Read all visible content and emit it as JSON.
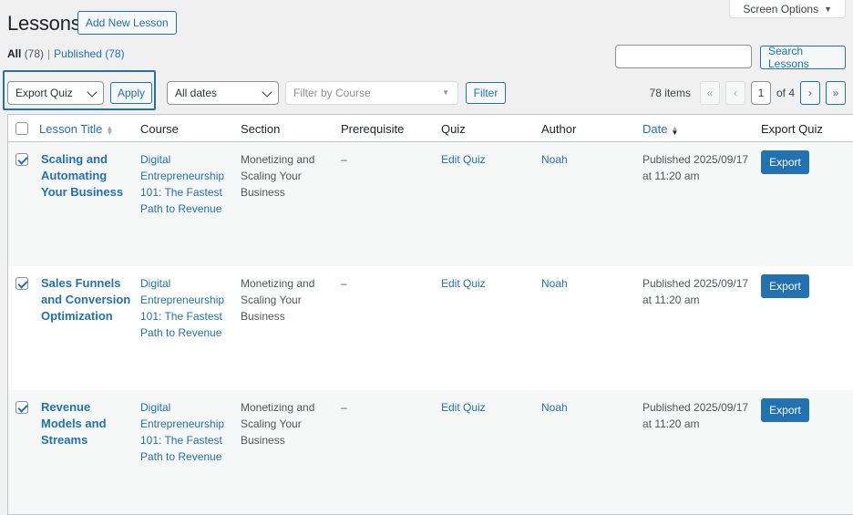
{
  "screen_options": {
    "label": "Screen Options",
    "caret": "▼"
  },
  "page_title": "Lessons",
  "add_new": "Add New Lesson",
  "views": {
    "all": {
      "label": "All",
      "count": "(78)"
    },
    "separator": "|",
    "published": {
      "label": "Published",
      "count": "(78)"
    }
  },
  "search": {
    "button": "Search Lessons",
    "value": ""
  },
  "bulk": {
    "selected": "Export Quiz",
    "apply": "Apply"
  },
  "filters": {
    "dates": "All dates",
    "course_placeholder": "Filter by Course",
    "filter_button": "Filter"
  },
  "pagination": {
    "items": "78 items",
    "first": "«",
    "prev": "‹",
    "current": "1",
    "of": "of 4",
    "next": "›",
    "last": "»"
  },
  "columns": {
    "title": "Lesson Title",
    "course": "Course",
    "section": "Section",
    "prerequisite": "Prerequisite",
    "quiz": "Quiz",
    "author": "Author",
    "date": "Date",
    "export": "Export Quiz"
  },
  "rows": [
    {
      "title": "Scaling and Automating Your Business",
      "course": "Digital Entrepreneurship 101: The Fastest Path to Revenue",
      "section": "Monetizing and Scaling Your Business",
      "prerequisite": "–",
      "quiz": "Edit Quiz",
      "author": "Noah",
      "date": "Published 2025/09/17 at 11:20 am",
      "export": "Export",
      "checked": true
    },
    {
      "title": "Sales Funnels and Conversion Optimization",
      "course": "Digital Entrepreneurship 101: The Fastest Path to Revenue",
      "section": "Monetizing and Scaling Your Business",
      "prerequisite": "–",
      "quiz": "Edit Quiz",
      "author": "Noah",
      "date": "Published 2025/09/17 at 11:20 am",
      "export": "Export",
      "checked": true
    },
    {
      "title": "Revenue Models and Streams",
      "course": "Digital Entrepreneurship 101: The Fastest Path to Revenue",
      "section": "Monetizing and Scaling Your Business",
      "prerequisite": "–",
      "quiz": "Edit Quiz",
      "author": "Noah",
      "date": "Published 2025/09/17 at 11:20 am",
      "export": "Export",
      "checked": true
    }
  ],
  "colors": {
    "accent": "#2271b1",
    "background": "#f0f0f1"
  }
}
